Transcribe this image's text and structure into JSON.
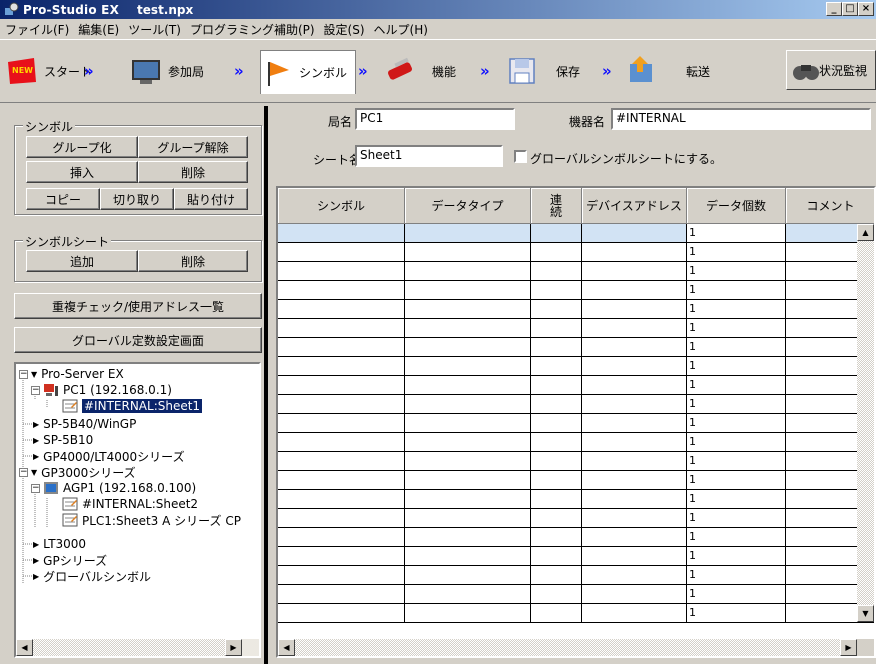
{
  "window": {
    "app_title": "Pro-Studio EX",
    "file_name": "test.npx",
    "min": "_",
    "max": "□",
    "close": "×"
  },
  "menu": [
    "ファイル(F)",
    "編集(E)",
    "ツール(T)",
    "プログラミング補助(P)",
    "設定(S)",
    "ヘルプ(H)"
  ],
  "toolbar": {
    "start": "スタート",
    "station": "参加局",
    "symbol": "シンボル",
    "function": "機能",
    "save": "保存",
    "transfer": "転送",
    "status": "状況監視",
    "arrow": "»"
  },
  "symbol_group": {
    "label": "シンボル",
    "group": "グループ化",
    "ungroup": "グループ解除",
    "insert": "挿入",
    "delete": "削除",
    "copy": "コピー",
    "cut": "切り取り",
    "paste": "貼り付け"
  },
  "sheet_group": {
    "label": "シンボルシート",
    "add": "追加",
    "delete": "削除"
  },
  "dup_check": "重複チェック/使用アドレス一覧",
  "global_const": "グローバル定数設定画面",
  "tree": [
    {
      "text": "Pro-Server EX"
    },
    {
      "text": "PC1 (192.168.0.1)"
    },
    {
      "text": "#INTERNAL:Sheet1"
    },
    {
      "text": "SP-5B40/WinGP"
    },
    {
      "text": "SP-5B10"
    },
    {
      "text": "GP4000/LT4000シリーズ"
    },
    {
      "text": "GP3000シリーズ"
    },
    {
      "text": "AGP1 (192.168.0.100)"
    },
    {
      "text": "#INTERNAL:Sheet2"
    },
    {
      "text": "PLC1:Sheet3 A シリーズ CP"
    },
    {
      "text": "LT3000"
    },
    {
      "text": "GPシリーズ"
    },
    {
      "text": "グローバルシンボル"
    }
  ],
  "form": {
    "station_label": "局名",
    "station_value": "PC1",
    "device_label": "機器名",
    "device_value": "#INTERNAL",
    "sheet_label": "シート名",
    "sheet_value": "Sheet1",
    "global_checkbox_label": "グローバルシンボルシートにする。"
  },
  "grid": {
    "headers": [
      "シンボル",
      "データタイプ",
      "連続",
      "デバイスアドレス",
      "データ個数",
      "コメント"
    ],
    "default_count": "1",
    "row_count": 21
  }
}
